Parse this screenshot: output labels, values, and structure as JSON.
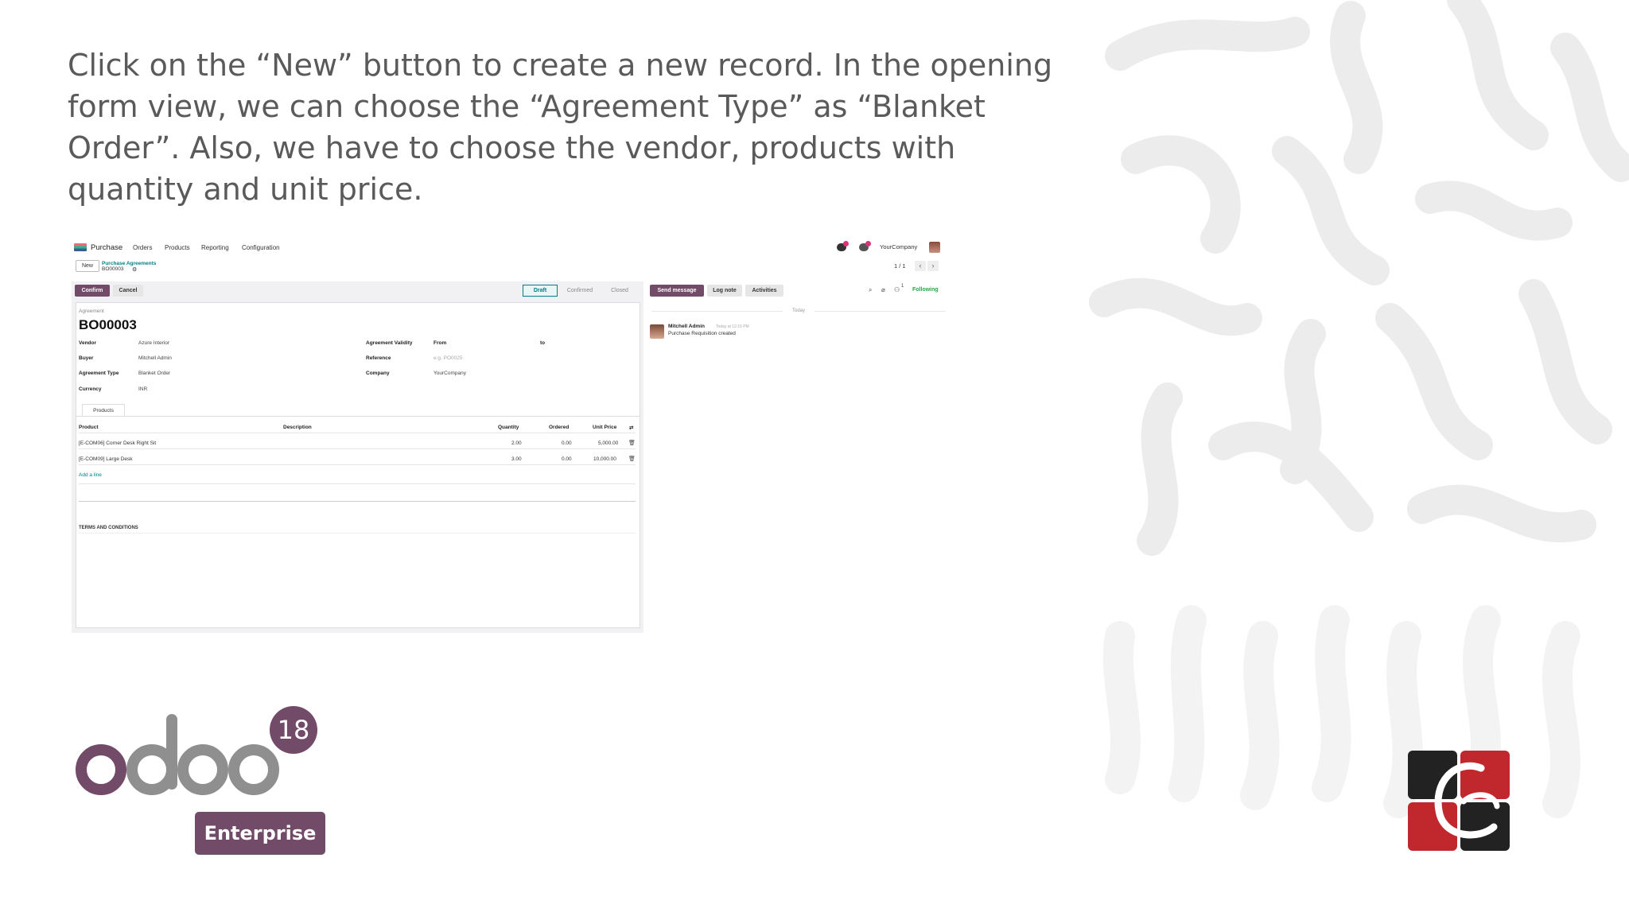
{
  "slide": {
    "instruction": "Click on the “New” button to create a new record. In the opening form view, we can choose the “Agreement Type” as “Blanket Order”. Also, we have to choose the vendor,  products with quantity and unit price."
  },
  "app": {
    "navbar": {
      "app_name": "Purchase",
      "menu": [
        "Orders",
        "Products",
        "Reporting",
        "Configuration"
      ],
      "company": "YourCompany"
    },
    "control_panel": {
      "new_label": "New",
      "breadcrumb_parent": "Purchase Agreements",
      "breadcrumb_record": "BO00003",
      "pager": "1 / 1"
    },
    "statusbar": {
      "confirm_label": "Confirm",
      "cancel_label": "Cancel",
      "stages": [
        "Draft",
        "Confirmed",
        "Closed"
      ],
      "active_stage": "Draft"
    },
    "form": {
      "record_label": "Agreement",
      "record_name": "BO00003",
      "left_fields": [
        {
          "label": "Vendor",
          "value": "Azure Interior"
        },
        {
          "label": "Buyer",
          "value": "Mitchell Admin"
        },
        {
          "label": "Agreement Type",
          "value": "Blanket Order"
        },
        {
          "label": "Currency",
          "value": "INR"
        }
      ],
      "validity_label": "Agreement Validity",
      "validity_from": "From",
      "validity_to": "to",
      "reference_label": "Reference",
      "reference_placeholder": "e.g. PO0025",
      "company_label": "Company",
      "company_value": "YourCompany",
      "tab_products": "Products",
      "columns": [
        "Product",
        "Description",
        "Quantity",
        "Ordered",
        "Unit Price"
      ],
      "lines": [
        {
          "product": "[E-COM06] Corner Desk Right Sit",
          "quantity": "2.00",
          "ordered": "0.00",
          "unit_price": "5,000.00"
        },
        {
          "product": "[E-COM09] Large Desk",
          "quantity": "3.00",
          "ordered": "0.00",
          "unit_price": "10,000.00"
        }
      ],
      "add_line": "Add a line",
      "terms_label": "TERMS AND CONDITIONS"
    },
    "chatter": {
      "send_message": "Send message",
      "log_note": "Log note",
      "activities": "Activities",
      "follower_count": "1",
      "following": "Following",
      "date_separator": "Today",
      "message": {
        "author": "Mitchell Admin",
        "time": "Today at 12:16 PM",
        "body": "Purchase Requisition created"
      }
    }
  },
  "branding": {
    "odoo_version": "18",
    "edition": "Enterprise",
    "colors": {
      "odoo_purple": "#714b67",
      "odoo_grey": "#8f8f8f",
      "brand_red": "#c0282d",
      "brand_dark": "#222222"
    }
  }
}
